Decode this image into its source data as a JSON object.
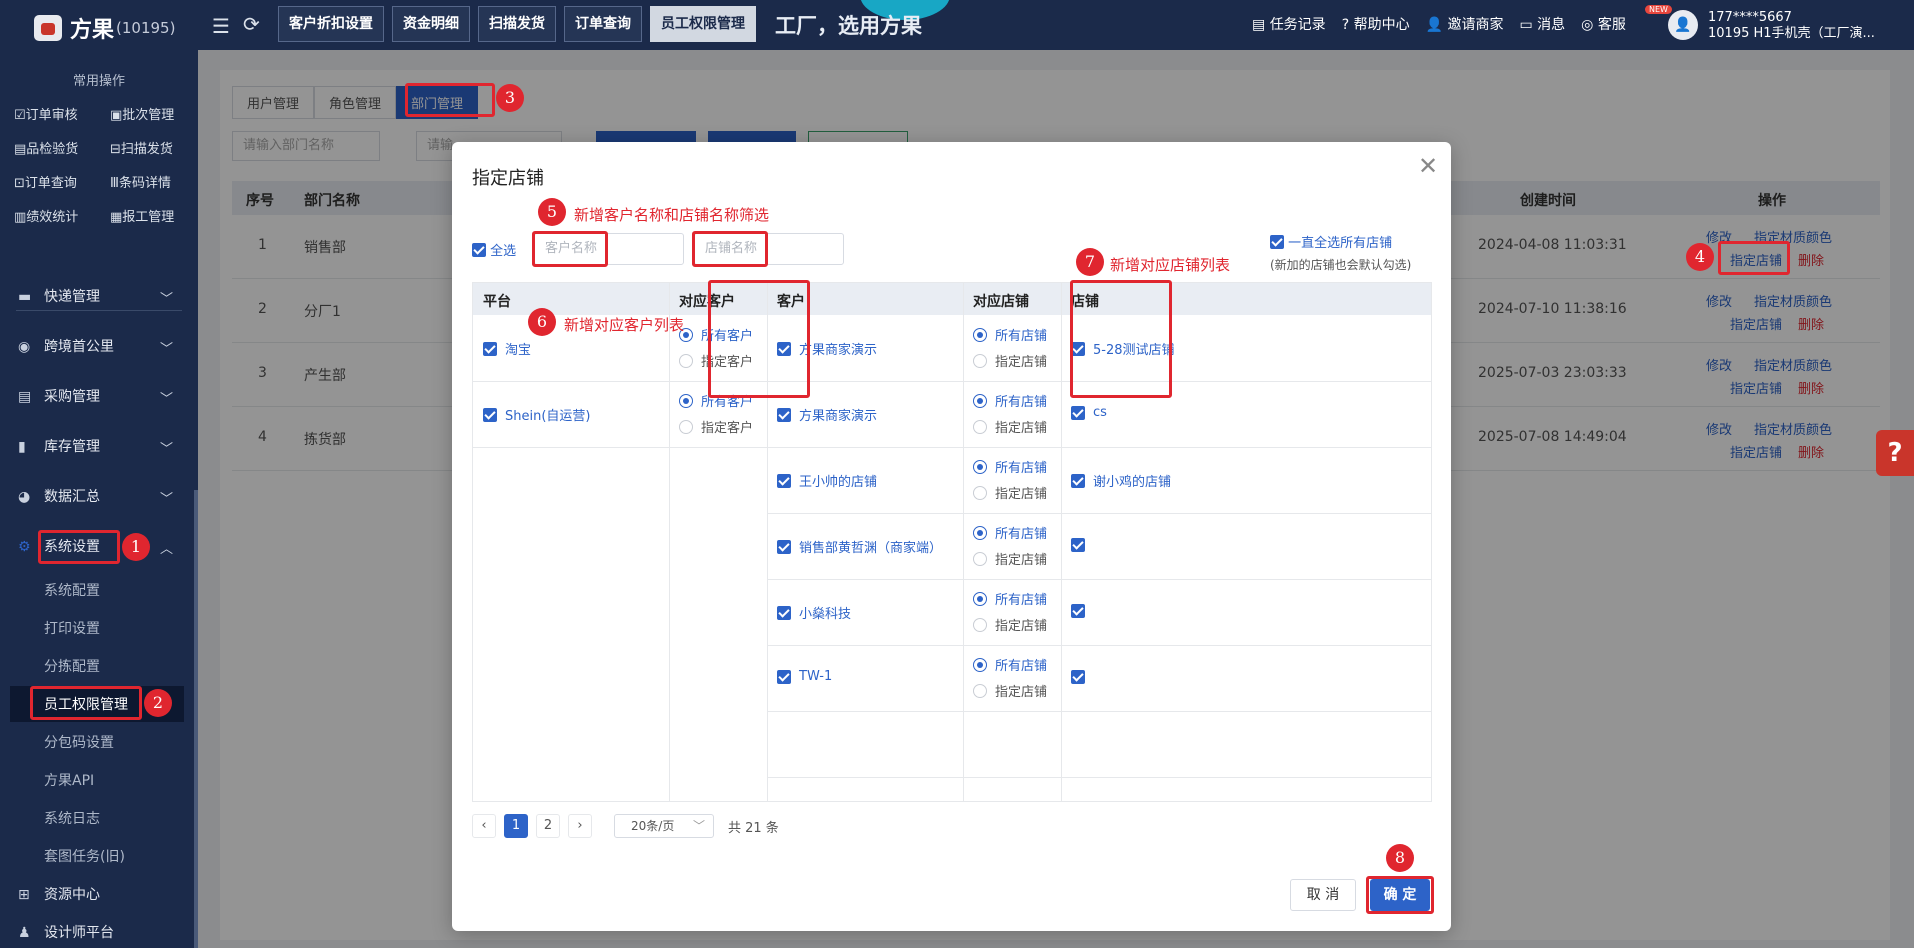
{
  "header": {
    "logo_name": "方果",
    "logo_id": "(10195)",
    "tabs": [
      "客户折扣设置",
      "资金明细",
      "扫描发货",
      "订单查询",
      "员工权限管理"
    ],
    "slogan": "工厂，选用方果",
    "right_items": [
      "任务记录",
      "帮助中心",
      "邀请商家",
      "消息",
      "客服"
    ],
    "new_badge": "NEW",
    "user_phone": "177****5667",
    "user_company": "10195 H1手机壳（工厂演..."
  },
  "sidebar": {
    "section_title": "常用操作",
    "quick": [
      "订单审核",
      "批次管理",
      "品检验货",
      "扫描发货",
      "订单查询",
      "条码详情",
      "绩效统计",
      "报工管理"
    ],
    "menus": [
      "快递管理",
      "跨境首公里",
      "采购管理",
      "库存管理",
      "数据汇总",
      "系统设置"
    ],
    "submenus": [
      "系统配置",
      "打印设置",
      "分拣配置",
      "员工权限管理",
      "分包码设置",
      "方果API",
      "系统日志",
      "套图任务(旧)"
    ],
    "bottom": [
      "资源中心",
      "设计师平台"
    ]
  },
  "bg": {
    "tabs": [
      "用户管理",
      "角色管理",
      "部门管理"
    ],
    "search_placeholder": "请输入部门名称",
    "search2_placeholder": "请输",
    "headers": [
      "序号",
      "部门名称",
      "创建时间",
      "操作"
    ],
    "rows": [
      {
        "no": "1",
        "name": "销售部",
        "time": "2024-04-08 11:03:31"
      },
      {
        "no": "2",
        "name": "分厂1",
        "time": "2024-07-10 11:38:16"
      },
      {
        "no": "3",
        "name": "产生部",
        "time": "2025-07-03 23:03:33"
      },
      {
        "no": "4",
        "name": "拣货部",
        "time": "2025-07-08 14:49:04"
      }
    ],
    "op_edit": "修改",
    "op_material": "指定材质颜色",
    "op_shop": "指定店铺",
    "op_delete": "删除"
  },
  "modal": {
    "title": "指定店铺",
    "select_all": "全选",
    "customer_placeholder": "客户名称",
    "shop_placeholder": "店铺名称",
    "always_select": "一直全选所有店铺",
    "always_note": "(新加的店铺也会默认勾选)",
    "headers": [
      "平台",
      "对应客户",
      "客户",
      "对应店铺",
      "店铺"
    ],
    "all_customers": "所有客户",
    "specified_customers": "指定客户",
    "all_shops": "所有店铺",
    "specified_shops": "指定店铺",
    "platforms": [
      "淘宝",
      "Shein(自运营)"
    ],
    "customers": [
      "方果商家演示",
      "方果商家演示",
      "王小帅的店铺",
      "销售部黄哲渊（商家端）",
      "小燊科技",
      "TW-1"
    ],
    "shops": [
      "5-28测试店铺",
      "cs",
      "谢小鸡的店铺",
      "",
      "",
      ""
    ],
    "pages": [
      "1",
      "2"
    ],
    "page_size": "20条/页",
    "total": "共 21 条",
    "cancel": "取 消",
    "confirm": "确 定"
  },
  "annotations": {
    "nums": [
      "1",
      "2",
      "3",
      "4",
      "5",
      "6",
      "7",
      "8"
    ],
    "note5": "新增客户名称和店铺名称筛选",
    "note6": "新增对应客户列表",
    "note7": "新增对应店铺列表"
  },
  "colors": {
    "accent": "#2d63c8",
    "sidebar_bg": "#1b2a4a",
    "annotation_red": "#e0262f"
  }
}
